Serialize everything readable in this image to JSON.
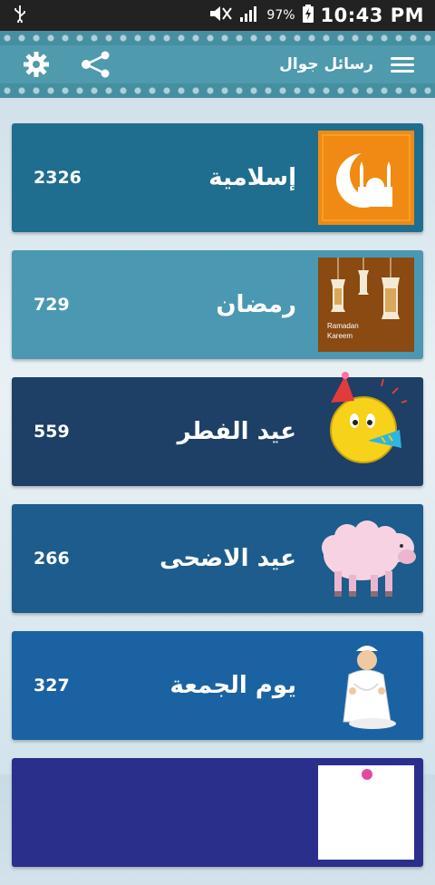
{
  "status_bar": {
    "usb_icon": "usb-icon",
    "battery_percent": "97%",
    "time": "10:43 PM"
  },
  "app_bar": {
    "title": "رسائل جوال",
    "icons": [
      "settings-gear-icon",
      "share-icon",
      "menu-hamburger-icon"
    ]
  },
  "categories": [
    {
      "label": "إسلامية",
      "count": "2326",
      "color": "#1f6d8f",
      "image": "islamic-crescent-mosque-icon"
    },
    {
      "label": "رمضان",
      "count": "729",
      "color": "#4a98b2",
      "image": "ramadan-lanterns-icon"
    },
    {
      "label": "عيد الفطر",
      "count": "559",
      "color": "#1e3f66",
      "image": "party-smiley-icon"
    },
    {
      "label": "عيد الاضحى",
      "count": "266",
      "color": "#1d5c8c",
      "image": "sheep-icon"
    },
    {
      "label": "يوم الجمعة",
      "count": "327",
      "color": "#1b62a2",
      "image": "praying-boy-icon"
    },
    {
      "label": "",
      "count": "",
      "color": "#2a2f8c",
      "image": "partial-card-icon"
    }
  ],
  "thumb_text": {
    "ramadan": "Ramadan Kareem"
  }
}
